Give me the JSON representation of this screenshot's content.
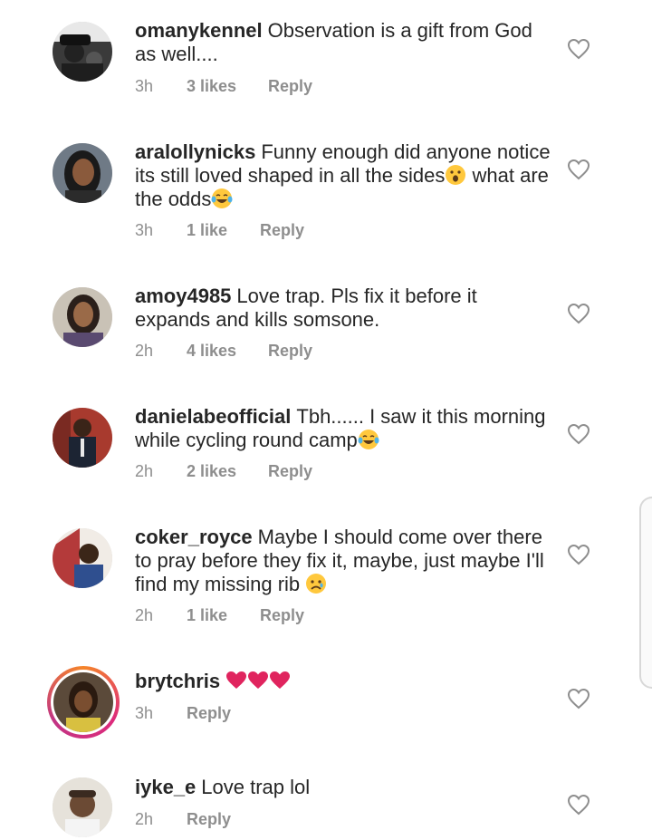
{
  "comments": [
    {
      "username": "omanykennel",
      "text": "Observation is a gift from God as well....",
      "time": "3h",
      "likes": "3 likes",
      "reply": "Reply"
    },
    {
      "username": "aralollynicks",
      "text": "Funny enough did anyone notice its still loved shaped in all the sides",
      "text2": " what are the odds",
      "time": "3h",
      "likes": "1 like",
      "reply": "Reply"
    },
    {
      "username": "amoy4985",
      "text": "Love trap. Pls fix it before it expands and kills somsone.",
      "time": "2h",
      "likes": "4 likes",
      "reply": "Reply"
    },
    {
      "username": "danielabeofficial",
      "text": "Tbh...... I saw it this morning while cycling round camp",
      "time": "2h",
      "likes": "2 likes",
      "reply": "Reply"
    },
    {
      "username": "coker_royce",
      "text": "Maybe I should come over there to pray before they fix it, maybe, just maybe I'll find my missing rib ",
      "time": "2h",
      "likes": "1 like",
      "reply": "Reply"
    },
    {
      "username": "brytchris",
      "text": "",
      "time": "3h",
      "likes": "",
      "reply": "Reply"
    },
    {
      "username": "iyke_e",
      "text": "Love trap lol",
      "time": "2h",
      "likes": "",
      "reply": "Reply"
    }
  ],
  "colors": {
    "text": "#262626",
    "meta": "#8e8e8e",
    "heart_emoji": "#e0245e",
    "story_ring": "#dd2a7b"
  },
  "icons": {
    "like": "heart-outline-icon",
    "emoji_surprised": "surprised-face-emoji",
    "emoji_laugh": "tears-of-joy-emoji",
    "emoji_sad": "sad-face-emoji",
    "emoji_heart": "red-heart-emoji"
  }
}
